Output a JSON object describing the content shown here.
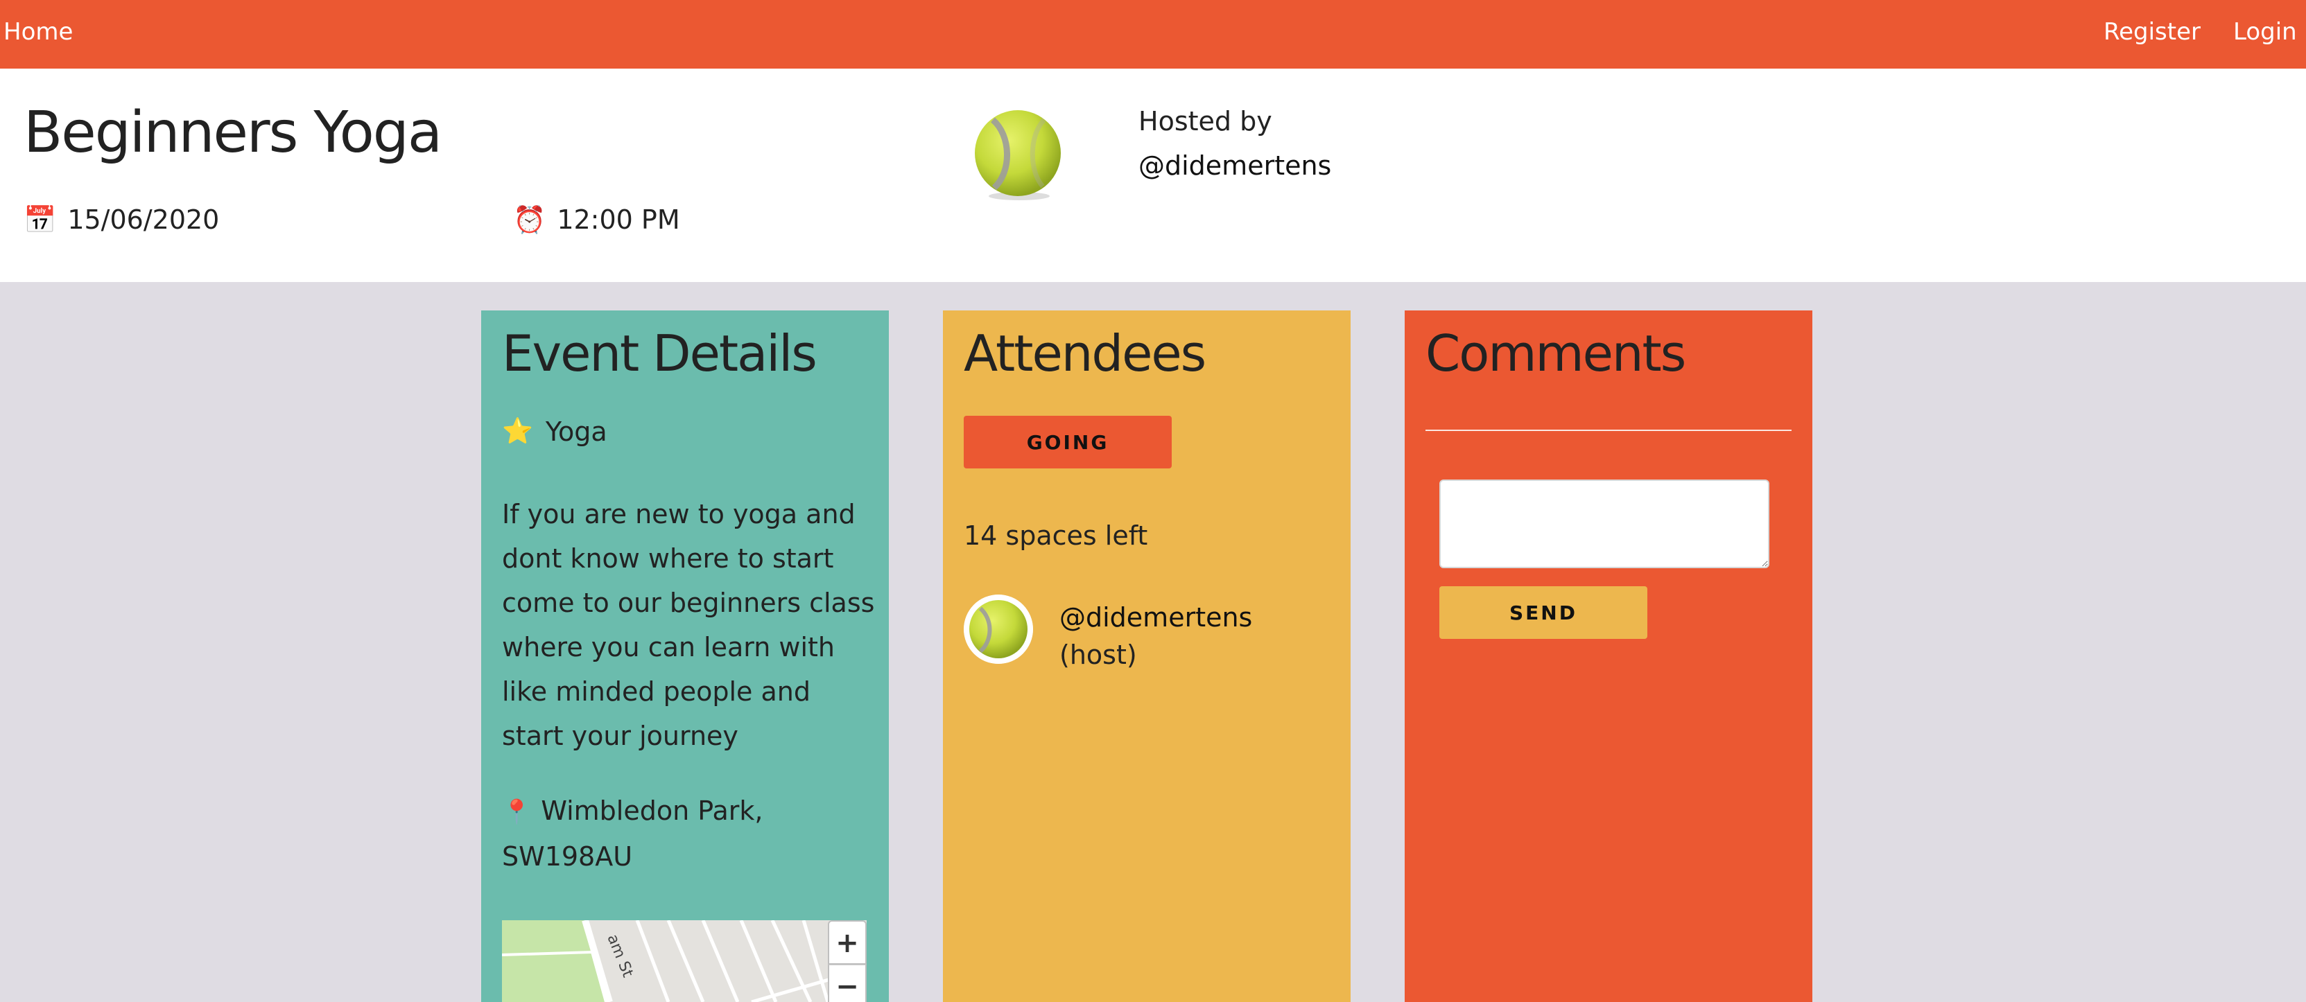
{
  "nav": {
    "home": "Home",
    "register": "Register",
    "login": "Login"
  },
  "event": {
    "title": "Beginners Yoga",
    "date": "15/06/2020",
    "time": "12:00 PM",
    "date_icon": "calendar-icon",
    "time_icon": "alarm-clock-icon",
    "hosted_label": "Hosted by",
    "host": "@didemertens",
    "host_avatar": "tennis-ball-avatar"
  },
  "details": {
    "title": "Event Details",
    "category": "Yoga",
    "category_icon": "star-icon",
    "description": "If you are new to yoga and dont know where to start come to our beginners class where you can learn with like minded people and start your journey",
    "location": "Wimbledon Park, SW198AU",
    "location_icon": "pin-icon",
    "map": {
      "street_label": "am St",
      "zoom_in": "+",
      "zoom_out": "−"
    }
  },
  "attendees": {
    "title": "Attendees",
    "going_label": "GOING",
    "spaces_left": "14 spaces left",
    "list": [
      {
        "name": "@didemertens",
        "role": "(host)"
      }
    ]
  },
  "comments": {
    "title": "Comments",
    "input_value": "",
    "send_label": "SEND"
  },
  "colors": {
    "navbar": "#eb5832",
    "details_card": "#6bbcad",
    "attendees_card": "#edb74e",
    "comments_card": "#eb5832",
    "page_bg": "#dfdce3"
  }
}
